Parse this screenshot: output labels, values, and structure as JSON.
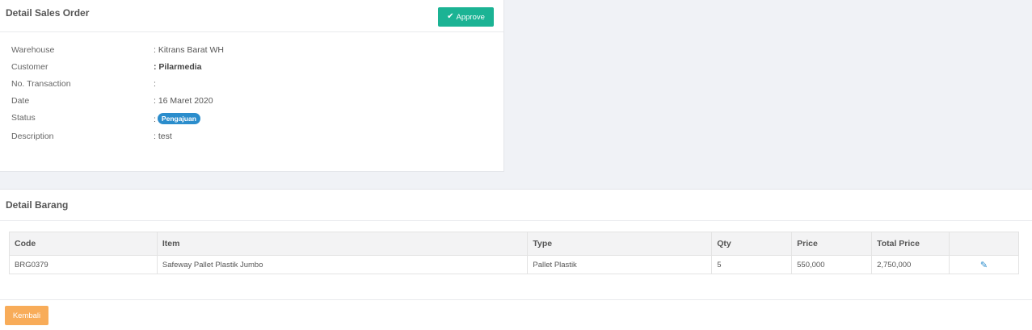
{
  "order": {
    "title": "Detail Sales Order",
    "approve_label": "Approve",
    "fields": [
      {
        "label": "Warehouse",
        "value": ": Kitrans Barat WH"
      },
      {
        "label": "Customer",
        "value": ": Pilarmedia"
      },
      {
        "label": "No. Transaction",
        "value": ":"
      },
      {
        "label": "Date",
        "value": ": 16 Maret 2020"
      },
      {
        "label": "Status",
        "value": ":",
        "badge": "Pengajuan"
      },
      {
        "label": "Description",
        "value": ": test"
      }
    ]
  },
  "items": {
    "title": "Detail Barang",
    "columns": [
      "Code",
      "Item",
      "Type",
      "Qty",
      "Price",
      "Total Price",
      ""
    ],
    "rows": [
      {
        "code": "BRG0379",
        "item": "Safeway Pallet Plastik Jumbo",
        "type": "Pallet Plastik",
        "qty": "5",
        "price": "550,000",
        "total": "2,750,000"
      }
    ]
  },
  "back_label": "Kembali",
  "colors": {
    "approve": "#1bb394",
    "badge": "#2b8dcc",
    "back": "#f8ac59"
  },
  "icons": {
    "approve": "check-icon",
    "edit": "edit-icon"
  }
}
